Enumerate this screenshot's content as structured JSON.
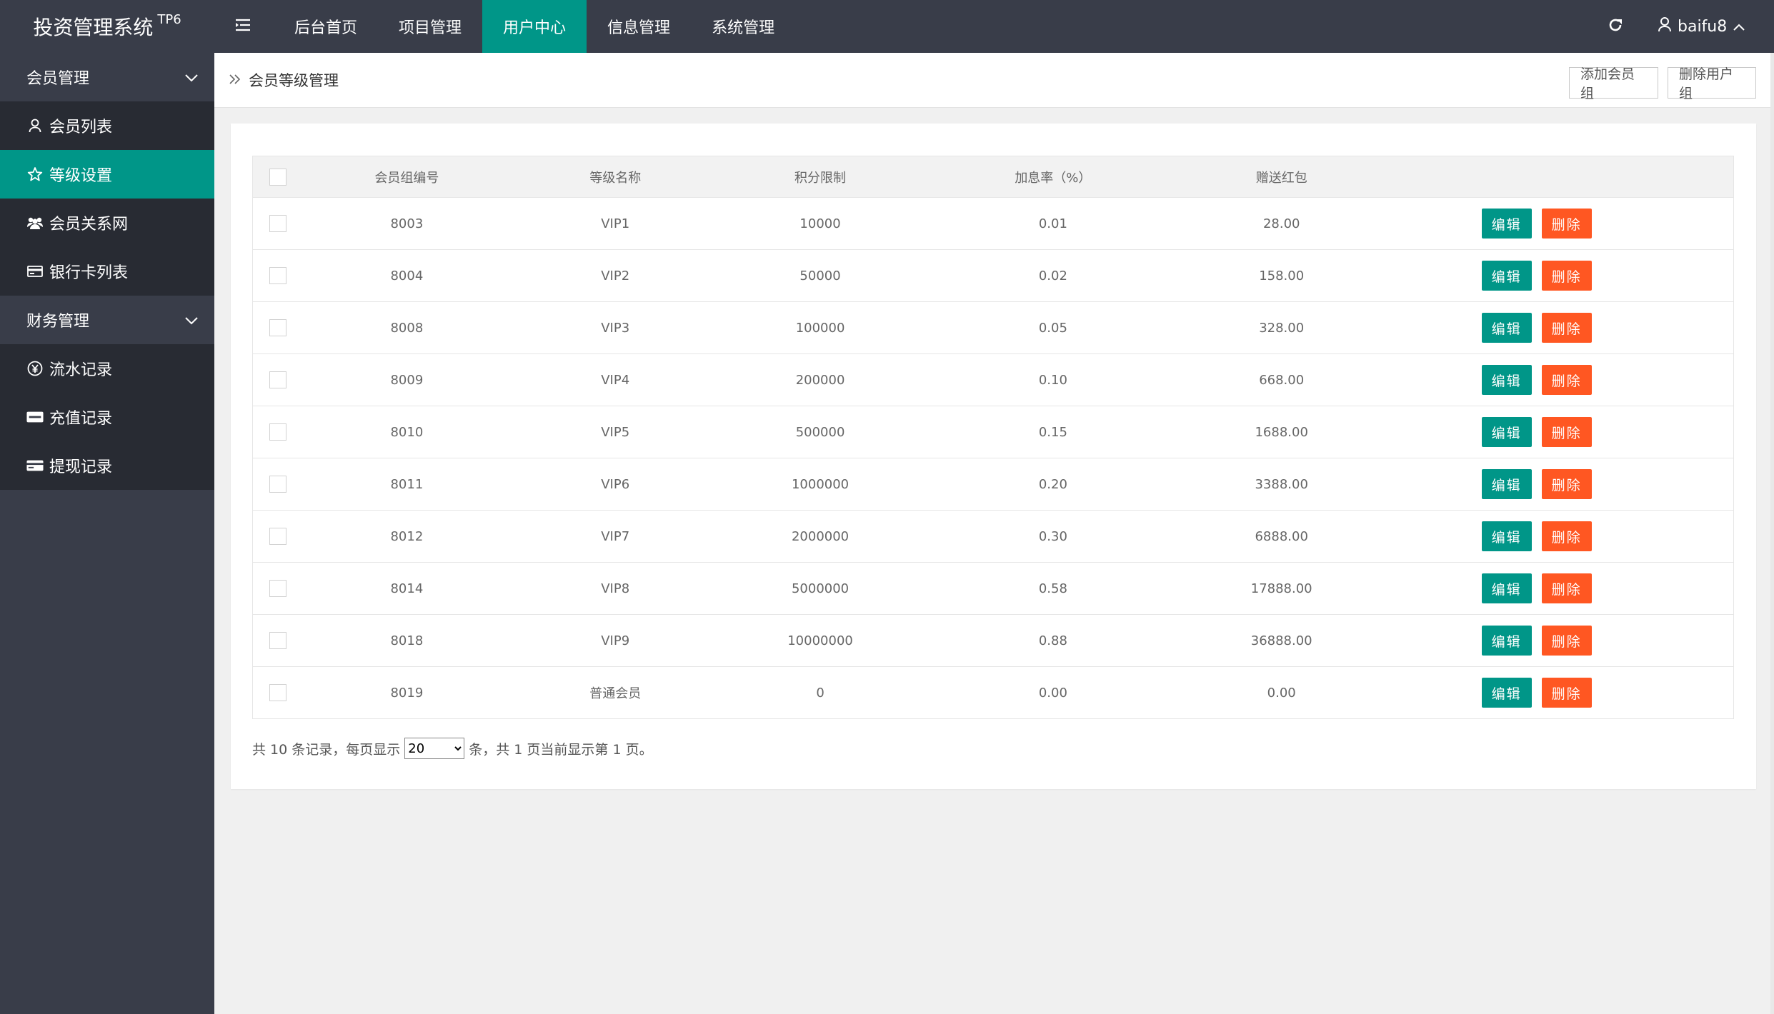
{
  "app": {
    "title": "投资管理系统",
    "version": "TP6"
  },
  "nav": [
    {
      "label": "后台首页",
      "active": false
    },
    {
      "label": "项目管理",
      "active": false
    },
    {
      "label": "用户中心",
      "active": true
    },
    {
      "label": "信息管理",
      "active": false
    },
    {
      "label": "系统管理",
      "active": false
    }
  ],
  "user": {
    "name": "baifu8"
  },
  "sidebar": {
    "groups": [
      {
        "label": "会员管理",
        "items": [
          {
            "label": "会员列表",
            "icon": "user-icon",
            "active": false
          },
          {
            "label": "等级设置",
            "icon": "star-icon",
            "active": true
          },
          {
            "label": "会员关系网",
            "icon": "users-icon",
            "active": false
          },
          {
            "label": "银行卡列表",
            "icon": "credit-card-icon",
            "active": false
          }
        ]
      },
      {
        "label": "财务管理",
        "items": [
          {
            "label": "流水记录",
            "icon": "yen-icon",
            "active": false
          },
          {
            "label": "充值记录",
            "icon": "paypal-icon",
            "active": false
          },
          {
            "label": "提现记录",
            "icon": "card-icon",
            "active": false
          }
        ]
      }
    ]
  },
  "breadcrumb": {
    "current": "会员等级管理"
  },
  "actions": {
    "add_group": "添加会员组",
    "delete_group": "删除用户组"
  },
  "table": {
    "headers": [
      "会员组编号",
      "等级名称",
      "积分限制",
      "加息率（%）",
      "赠送红包"
    ],
    "rows": [
      [
        "8003",
        "VIP1",
        "10000",
        "0.01",
        "28.00"
      ],
      [
        "8004",
        "VIP2",
        "50000",
        "0.02",
        "158.00"
      ],
      [
        "8008",
        "VIP3",
        "100000",
        "0.05",
        "328.00"
      ],
      [
        "8009",
        "VIP4",
        "200000",
        "0.10",
        "668.00"
      ],
      [
        "8010",
        "VIP5",
        "500000",
        "0.15",
        "1688.00"
      ],
      [
        "8011",
        "VIP6",
        "1000000",
        "0.20",
        "3388.00"
      ],
      [
        "8012",
        "VIP7",
        "2000000",
        "0.30",
        "6888.00"
      ],
      [
        "8014",
        "VIP8",
        "5000000",
        "0.58",
        "17888.00"
      ],
      [
        "8018",
        "VIP9",
        "10000000",
        "0.88",
        "36888.00"
      ],
      [
        "8019",
        "普通会员",
        "0",
        "0.00",
        "0.00"
      ]
    ],
    "edit_label": "编辑",
    "delete_label": "删除"
  },
  "pager": {
    "prefix": "共 10 条记录，每页显示",
    "per_page": "20",
    "suffix": "条，共 1 页当前显示第 1 页。"
  },
  "colors": {
    "header_bg": "#393d49",
    "accent": "#009688",
    "danger": "#ff5722",
    "submenu_bg": "#282b33"
  }
}
